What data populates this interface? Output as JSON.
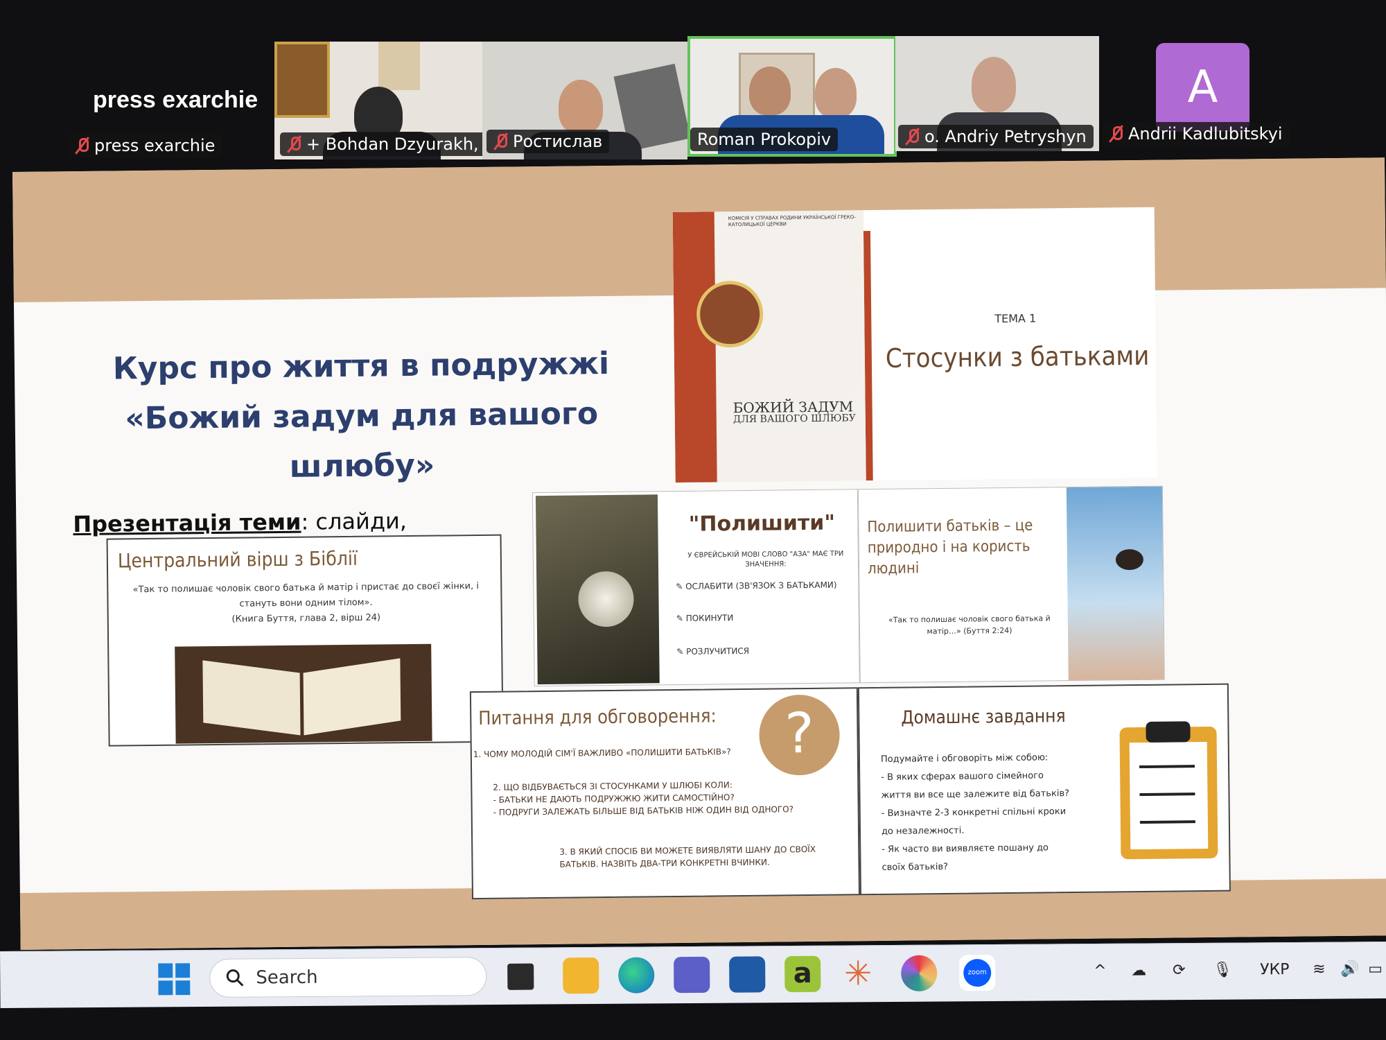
{
  "meeting": {
    "self_display_name": "press exarchie",
    "self_label": "press exarchie",
    "participants": [
      {
        "name": "+ Bohdan Dzyurakh, G...",
        "muted": true
      },
      {
        "name": "Ростислав",
        "muted": true
      },
      {
        "name": "Roman Prokopiv",
        "muted": false,
        "speaking": true
      },
      {
        "name": "o. Andriy Petryshyn",
        "muted": true
      },
      {
        "name": "Andrii Kadlubitskyi",
        "muted": true,
        "avatar_letter": "A"
      }
    ]
  },
  "slide": {
    "title_line1": "Курс про життя в подружжі",
    "title_line2": "«Божий задум для вашого шлюбу»",
    "presentation_label": "Презентація теми",
    "presentation_suffix": ": слайди,",
    "book_cover": {
      "publisher": "КОМІСІЯ У СПРАВАХ РОДИНИ УКРАЇНСЬКОЇ ГРЕКО-КАТОЛИЦЬКОЇ ЦЕРКВИ",
      "title_line1": "БОЖИЙ ЗАДУМ",
      "title_line2": "ДЛЯ ВАШОГО ШЛЮБУ"
    },
    "topic_slide": {
      "label": "ТЕМА 1",
      "title": "Стосунки з батьками"
    },
    "verse_slide": {
      "title": "Центральний вірш з Біблії",
      "quote": "«Так то полишає чоловік свого батька й матір і пристає до своєї жінки, і стануть вони одним тілом».",
      "reference": "(Книга Буття, глава 2, вірш 24)"
    },
    "leave_slide": {
      "title": "\"Полишити\"",
      "intro": "У ЄВРЕЙСЬКІЙ МОВІ СЛОВО \"АЗА\" МАЄ ТРИ ЗНАЧЕННЯ:",
      "items": [
        "ОСЛАБИТИ (ЗВ'ЯЗОК З БАТЬКАМИ)",
        "ПОКИНУТИ",
        "РОЗЛУЧИТИСЯ"
      ]
    },
    "leave_parents_slide": {
      "title": "Полишити батьків – це природно і на користь людині",
      "quote": "«Так то полишає чоловік свого батька й матір…» (Буття 2:24)"
    },
    "questions_slide": {
      "title": "Питання для обговорення:",
      "q1": "1. ЧОМУ МОЛОДІЙ СІМ'Ї ВАЖЛИВО «ПОЛИШИТИ БАТЬКІВ»?",
      "q2_lines": [
        "2. ЩО ВІДБУВАЄТЬСЯ ЗІ СТОСУНКАМИ У ШЛЮБІ КОЛИ:",
        "- БАТЬКИ НЕ ДАЮТЬ ПОДРУЖЖЮ ЖИТИ САМОСТІЙНО?",
        "- ПОДРУГИ ЗАЛЕЖАТЬ БІЛЬШЕ ВІД БАТЬКІВ НІЖ ОДИН ВІД ОДНОГО?"
      ],
      "q3_lines": [
        "3. В ЯКИЙ СПОСІБ ВИ МОЖЕТЕ ВИЯВЛЯТИ ШАНУ ДО СВОЇХ",
        "БАТЬКІВ. НАЗВІТЬ ДВА-ТРИ КОНКРЕТНІ ВЧИНКИ."
      ]
    },
    "homework_slide": {
      "title": "Домашнє завдання",
      "lines": [
        "Подумайте і обговоріть між собою:",
        "- В яких сферах вашого сімейного",
        "життя ви все ще залежите від батьків?",
        "- Визначте 2-3 конкретні спільні кроки",
        "до незалежності.",
        "- Як часто ви виявляєте пошану до",
        "своїх батьків?"
      ]
    }
  },
  "taskbar": {
    "search_placeholder": "Search",
    "language": "УКР",
    "apps": [
      "start-icon",
      "file-explorer-icon",
      "edge-icon",
      "teams-icon",
      "store-icon",
      "a-app-icon",
      "sun-app-icon",
      "color-wheel-icon",
      "zoom-icon"
    ],
    "zoom_label": "zoom"
  }
}
